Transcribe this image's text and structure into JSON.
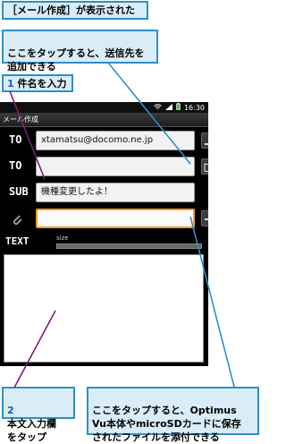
{
  "header_label": "［メール作成］が表示された",
  "callout_add_dest": "ここをタップすると、送信先を\n追加できる",
  "step1": {
    "num": "1",
    "text": "件名を入力"
  },
  "step2": {
    "num": "2",
    "text": "本文入力欄\nをタップ"
  },
  "callout_attach": "ここをタップすると、Optimus\nVu本体やmicroSDカードに保存\nされたファイルを添付できる",
  "phone": {
    "status_time": "16:30",
    "title": "メール作成",
    "to_label": "TO",
    "to_value": "xtamatsu@docomo.ne.jp",
    "to2_label": "TO",
    "to2_value": "",
    "sub_label": "SUB",
    "sub_value": "機種変更したよ！",
    "text_label": "TEXT",
    "size_label": "size"
  }
}
